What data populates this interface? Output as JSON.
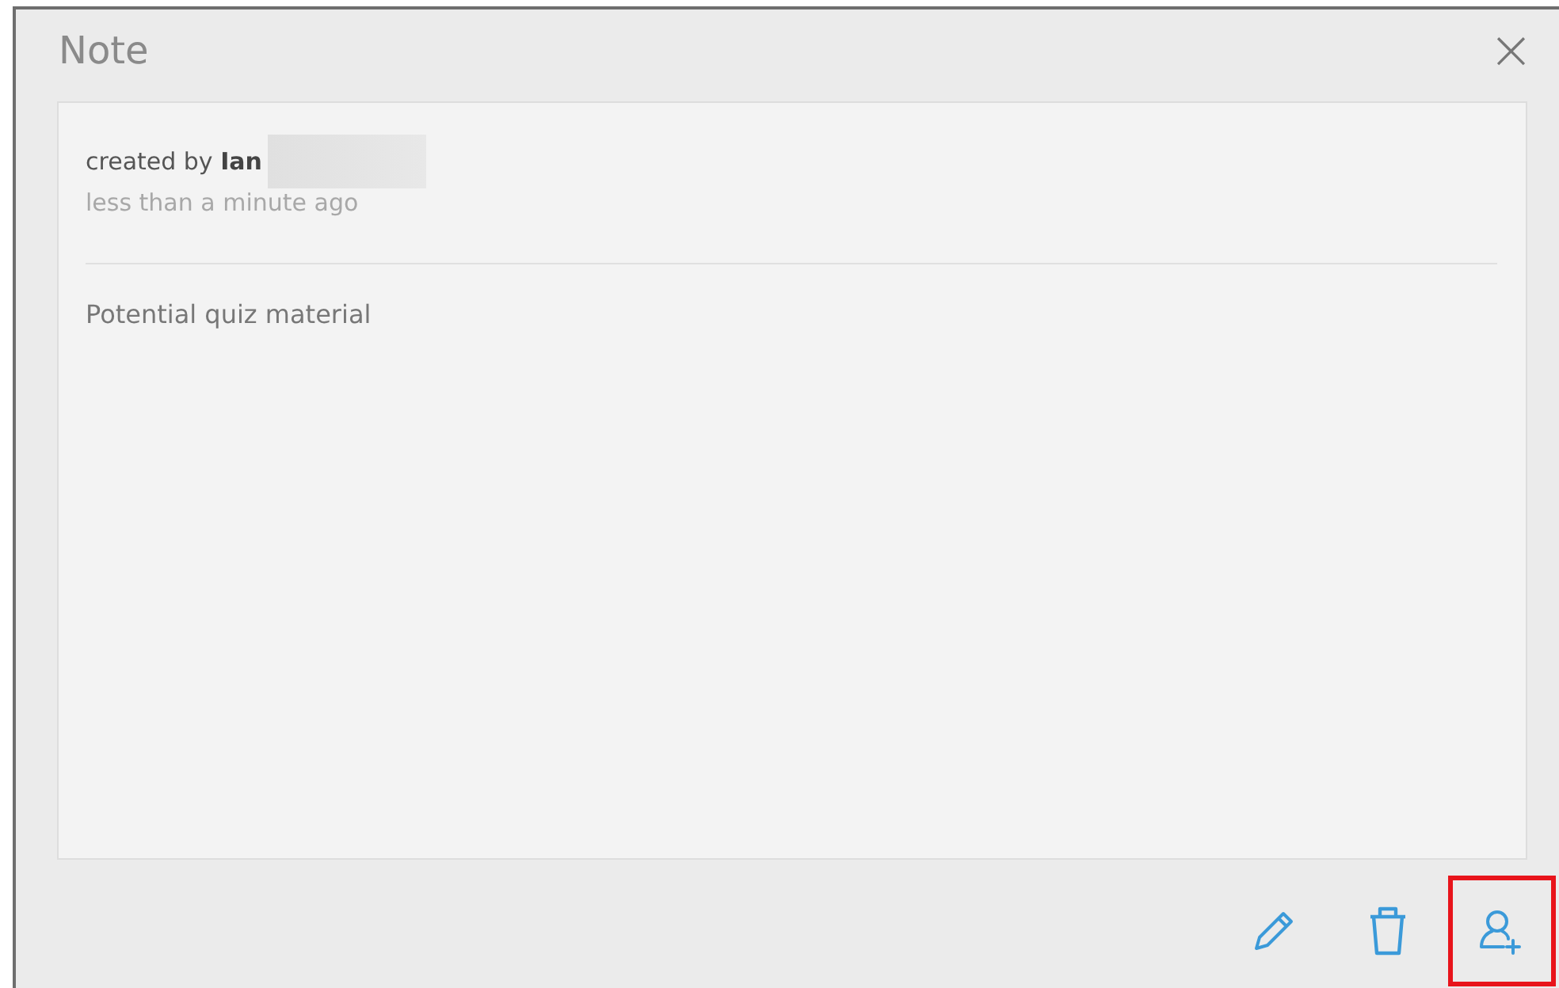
{
  "dialog": {
    "title": "Note",
    "close": "×"
  },
  "note": {
    "created_by_label": "created by",
    "author": "Ian",
    "author_redacted": true,
    "time": "less than a minute ago",
    "body": "Potential quiz material"
  },
  "actions": [
    {
      "kind": "edit",
      "highlighted": false
    },
    {
      "kind": "delete",
      "highlighted": false
    },
    {
      "kind": "share",
      "highlighted": true
    }
  ]
}
